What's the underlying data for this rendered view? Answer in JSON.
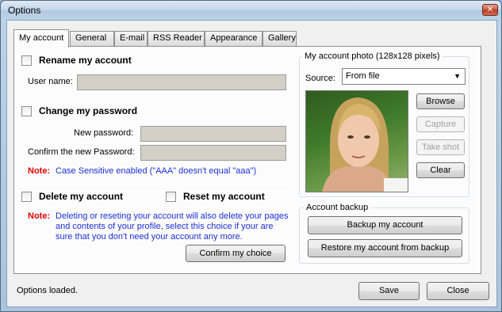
{
  "window": {
    "title": "Options",
    "close_glyph": "✕"
  },
  "tabs": [
    {
      "label": "My account",
      "active": true
    },
    {
      "label": "General"
    },
    {
      "label": "E-mail"
    },
    {
      "label": "RSS Reader"
    },
    {
      "label": "Appearance"
    },
    {
      "label": "Gallery"
    }
  ],
  "rename": {
    "checkbox_label": "Rename my account",
    "checked": false,
    "user_name_label": "User name:",
    "user_name_value": ""
  },
  "password": {
    "checkbox_label": "Change my password",
    "checked": false,
    "new_label": "New password:",
    "confirm_label": "Confirm the new Password:",
    "note_label": "Note:",
    "note_text": "Case Sensitive enabled (\"AAA\"  doesn't equal  \"aaa\")"
  },
  "delete": {
    "checkbox_label": "Delete my account",
    "checked": false
  },
  "reset": {
    "checkbox_label": "Reset my account",
    "checked": false
  },
  "delete_note": {
    "label": "Note:",
    "line1": "Deleting or reseting your account will also delete your pages",
    "line2": "and contents of your profile, select this choice if your are",
    "line3": "sure that you don't need your account any more."
  },
  "confirm_button": "Confirm my choice",
  "photo": {
    "group_title": "My account photo (128x128 pixels)",
    "source_label": "Source:",
    "source_value": "From file",
    "buttons": {
      "browse": "Browse",
      "capture": "Capture",
      "take_shot": "Take shot",
      "clear": "Clear"
    }
  },
  "backup": {
    "group_title": "Account backup",
    "backup_button": "Backup my account",
    "restore_button": "Restore my account from backup"
  },
  "footer": {
    "status": "Options loaded.",
    "save": "Save",
    "close": "Close"
  },
  "colors": {
    "note_red": "#e00000",
    "note_blue": "#1c2ed8",
    "field_gray": "#d4d0c8"
  }
}
